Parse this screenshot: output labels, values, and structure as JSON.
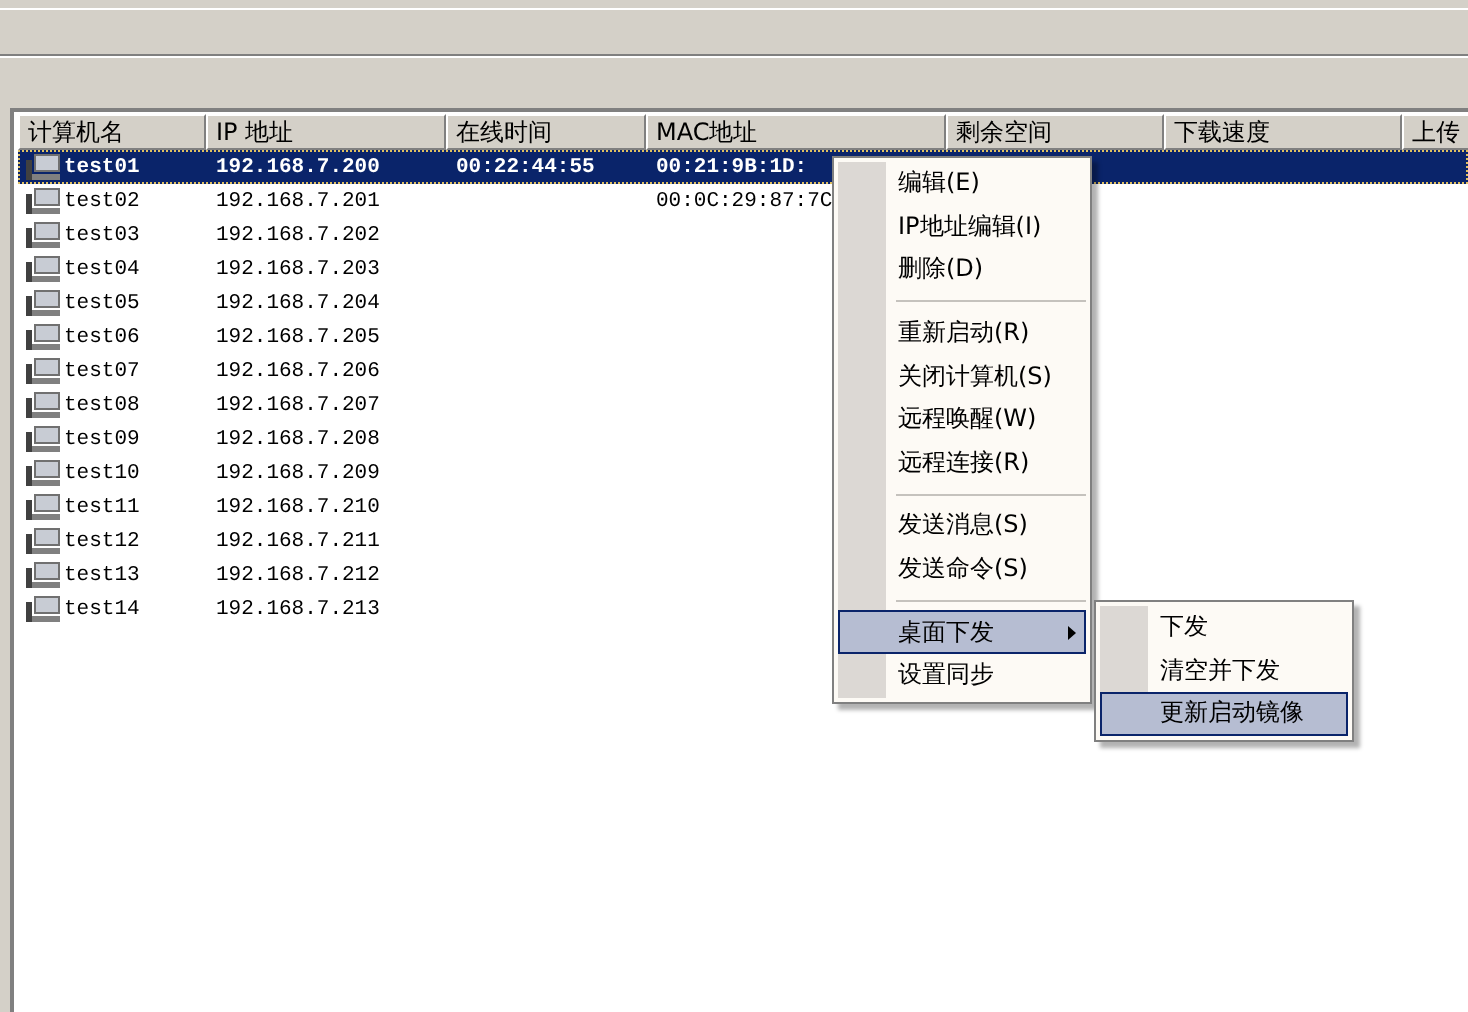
{
  "table": {
    "columns": [
      "计算机名",
      "IP 地址",
      "在线时间",
      "MAC地址",
      "剩余空间",
      "下载速度",
      "上传"
    ],
    "rows": [
      {
        "name": "test01",
        "ip": "192.168.7.200",
        "online": "00:22:44:55",
        "mac": "00:21:9B:1D:",
        "selected": true
      },
      {
        "name": "test02",
        "ip": "192.168.7.201",
        "online": "",
        "mac": "00:0C:29:87:7C",
        "selected": false
      },
      {
        "name": "test03",
        "ip": "192.168.7.202",
        "selected": false
      },
      {
        "name": "test04",
        "ip": "192.168.7.203",
        "selected": false
      },
      {
        "name": "test05",
        "ip": "192.168.7.204",
        "selected": false
      },
      {
        "name": "test06",
        "ip": "192.168.7.205",
        "selected": false
      },
      {
        "name": "test07",
        "ip": "192.168.7.206",
        "selected": false
      },
      {
        "name": "test08",
        "ip": "192.168.7.207",
        "selected": false
      },
      {
        "name": "test09",
        "ip": "192.168.7.208",
        "selected": false
      },
      {
        "name": "test10",
        "ip": "192.168.7.209",
        "selected": false
      },
      {
        "name": "test11",
        "ip": "192.168.7.210",
        "selected": false
      },
      {
        "name": "test12",
        "ip": "192.168.7.211",
        "selected": false
      },
      {
        "name": "test13",
        "ip": "192.168.7.212",
        "selected": false
      },
      {
        "name": "test14",
        "ip": "192.168.7.213",
        "selected": false
      }
    ]
  },
  "context_menu": {
    "items": [
      {
        "kind": "item",
        "label": "编辑(E)",
        "selected": false
      },
      {
        "kind": "item",
        "label": "IP地址编辑(I)",
        "selected": false
      },
      {
        "kind": "item",
        "label": "删除(D)",
        "selected": false
      },
      {
        "kind": "separator"
      },
      {
        "kind": "item",
        "label": "重新启动(R)",
        "selected": false
      },
      {
        "kind": "item",
        "label": "关闭计算机(S)",
        "selected": false
      },
      {
        "kind": "item",
        "label": "远程唤醒(W)",
        "selected": false
      },
      {
        "kind": "item",
        "label": "远程连接(R)",
        "selected": false
      },
      {
        "kind": "separator"
      },
      {
        "kind": "item",
        "label": "发送消息(S)",
        "selected": false
      },
      {
        "kind": "item",
        "label": "发送命令(S)",
        "selected": false
      },
      {
        "kind": "separator"
      },
      {
        "kind": "submenu",
        "label": "桌面下发",
        "selected": true
      },
      {
        "kind": "item",
        "label": "设置同步",
        "selected": false
      }
    ]
  },
  "submenu": {
    "items": [
      {
        "label": "下发",
        "selected": false
      },
      {
        "label": "清空并下发",
        "selected": false
      },
      {
        "label": "更新启动镜像",
        "selected": true
      }
    ]
  }
}
